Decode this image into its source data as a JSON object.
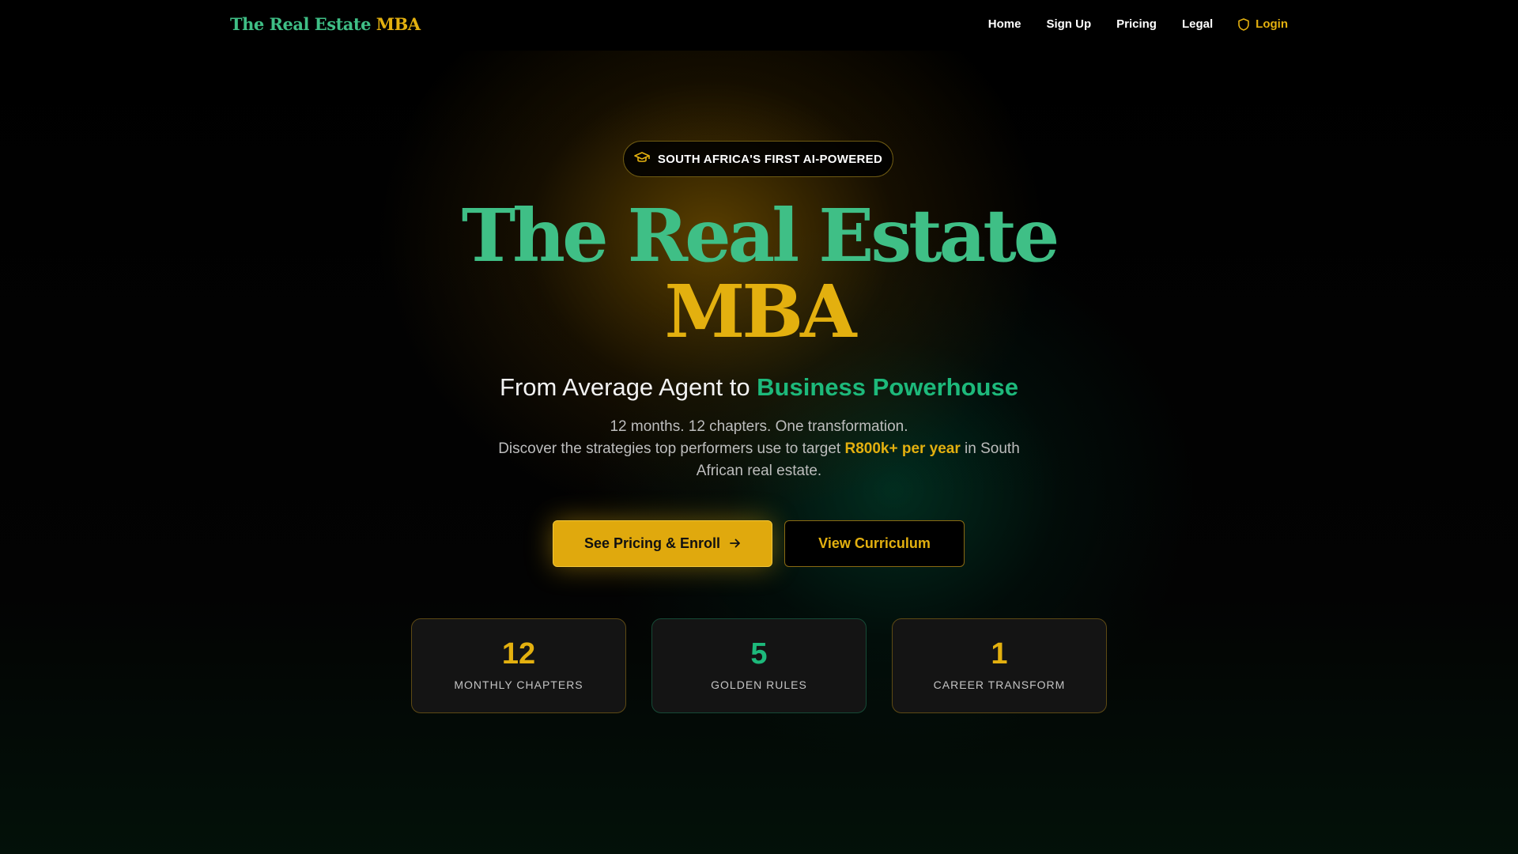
{
  "nav": {
    "brand_part1": "The Real Estate",
    "brand_part2": "MBA",
    "links": [
      "Home",
      "Sign Up",
      "Pricing",
      "Legal"
    ],
    "login_label": "Login",
    "login_icon": "shield-icon"
  },
  "hero": {
    "badge_icon": "graduation-cap-icon",
    "badge_text": "SOUTH AFRICA'S FIRST AI-POWERED",
    "title_line1": "The Real Estate",
    "title_line2": "MBA",
    "subtitle_prefix": "From Average Agent to ",
    "subtitle_highlight": "Business Powerhouse",
    "desc_line1": "12 months. 12 chapters. One transformation.",
    "desc_line2_prefix": "Discover the strategies top performers use to target ",
    "desc_line2_highlight": "R800k+ per year",
    "desc_line2_suffix": " in South African real estate.",
    "primary_button": "See Pricing & Enroll",
    "primary_button_icon": "arrow-right-icon",
    "secondary_button": "View Curriculum"
  },
  "stats": [
    {
      "value": "12",
      "label": "MONTHLY CHAPTERS",
      "color": "#e3b00f"
    },
    {
      "value": "5",
      "label": "GOLDEN RULES",
      "color": "#1db97b"
    },
    {
      "value": "1",
      "label": "CAREER TRANSFORM",
      "color": "#e3b00f"
    }
  ],
  "colors": {
    "accent_gold": "#e3b00f",
    "accent_green": "#3fbf86",
    "background": "#000000"
  }
}
